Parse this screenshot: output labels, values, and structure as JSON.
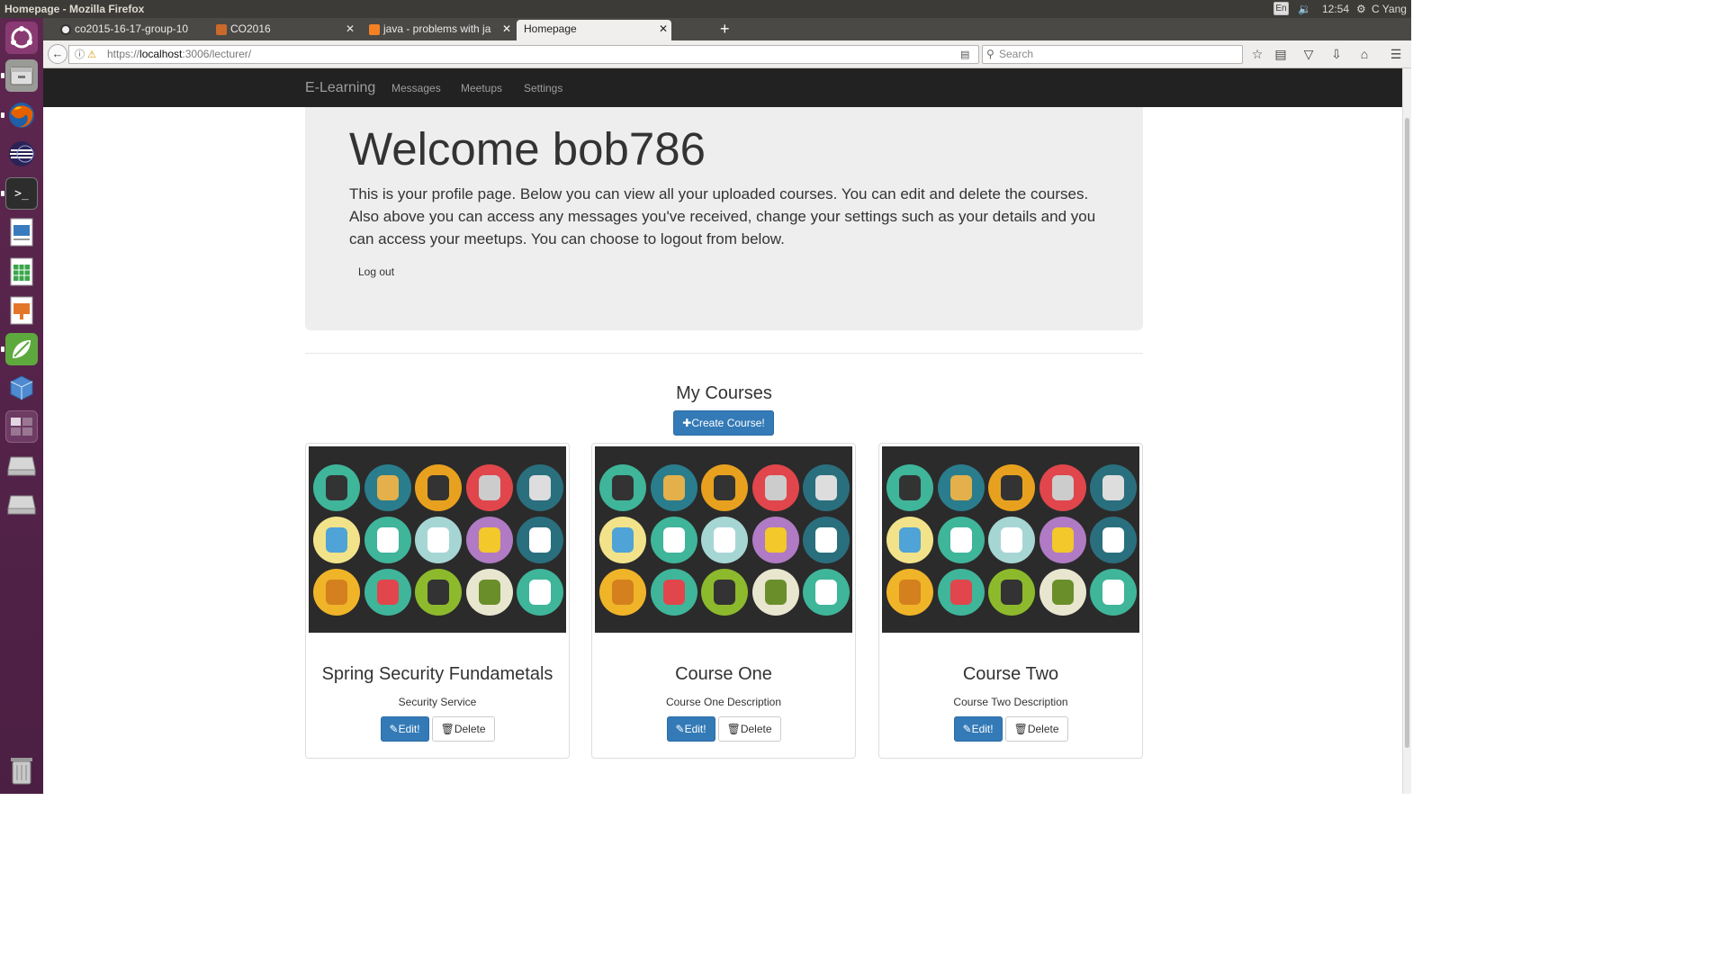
{
  "os_panel": {
    "window_title": "Homepage - Mozilla Firefox",
    "keyboard": "En",
    "time": "12:54",
    "user": "C Yang"
  },
  "launcher": {
    "items": [
      "ubuntu-dash-icon",
      "files-icon",
      "firefox-icon",
      "eclipse-icon",
      "terminal-icon",
      "writer-icon",
      "calc-icon",
      "impress-icon",
      "spring-tool-icon",
      "virtualbox-icon",
      "workspace-icon",
      "drive-icon",
      "drive-icon",
      "trash-icon"
    ]
  },
  "browser": {
    "tabs": [
      {
        "label": "co2015-16-17-group-10",
        "icon": "github-icon"
      },
      {
        "label": "CO2016",
        "icon": "moodle-icon"
      },
      {
        "label": "java - problems with ja",
        "icon": "stackoverflow-icon"
      },
      {
        "label": "Homepage",
        "active": true
      }
    ],
    "url_prefix": "https://",
    "url_host": "localhost",
    "url_rest": ":3006/lecturer/",
    "search_placeholder": "Search"
  },
  "site": {
    "brand": "E-Learning",
    "nav": [
      "Messages",
      "Meetups",
      "Settings"
    ]
  },
  "jumbotron": {
    "heading": "Welcome bob786",
    "text": "This is your profile page. Below you can view all your uploaded courses. You can edit and delete the courses. Also above you can access any messages you've received, change your settings such as your details and you can access your meetups. You can choose to logout from below.",
    "logout_label": "Log out"
  },
  "courses_section": {
    "heading": "My Courses",
    "create_label": "✚Create Course!"
  },
  "courses": [
    {
      "title": "Spring Security Fundametals",
      "description": "Security Service",
      "edit_label": "Edit!",
      "delete_label": "Delete"
    },
    {
      "title": "Course One",
      "description": "Course One Description",
      "edit_label": "Edit!",
      "delete_label": "Delete"
    },
    {
      "title": "Course Two",
      "description": "Course Two Description",
      "edit_label": "Edit!",
      "delete_label": "Delete"
    }
  ],
  "colors": {
    "primary": "#337ab7",
    "navbar": "#222222",
    "jumbotron": "#eeeeee",
    "launcher": "#5e2750"
  }
}
